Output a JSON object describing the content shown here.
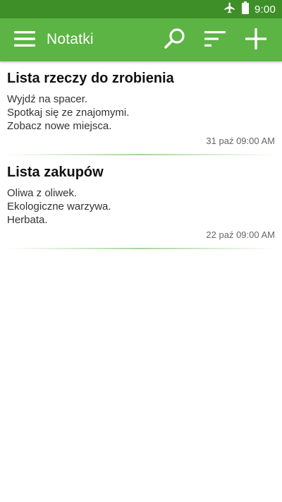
{
  "status_bar": {
    "time": "9:00",
    "icons": [
      "airplane-icon",
      "battery-icon"
    ]
  },
  "app_bar": {
    "title": "Notatki",
    "icons": [
      "menu-icon",
      "search-icon",
      "sort-icon",
      "add-icon"
    ],
    "color": "#5bb443",
    "status_color": "#3e8f28"
  },
  "notes": [
    {
      "title": "Lista rzeczy do zrobienia",
      "lines": [
        "Wyjdź na spacer.",
        "Spotkaj się ze znajomymi.",
        "Zobacz nowe miejsca."
      ],
      "date": "31 paź 09:00 AM"
    },
    {
      "title": "Lista zakupów",
      "lines": [
        "Oliwa z oliwek.",
        "Ekologiczne warzywa.",
        "Herbata."
      ],
      "date": "22 paź 09:00 AM"
    }
  ]
}
